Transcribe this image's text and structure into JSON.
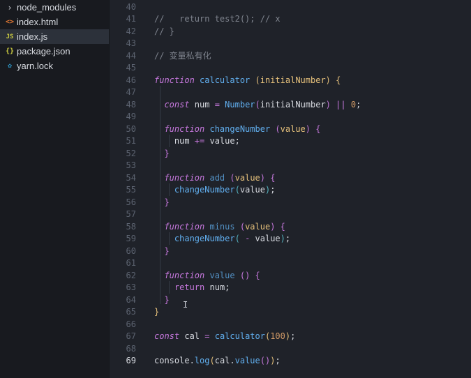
{
  "sidebar": {
    "files": [
      {
        "icon": "chevron-right-icon",
        "glyph": "›",
        "label": "node_modules",
        "type": "folder"
      },
      {
        "icon": "html-file-icon",
        "glyph": "<>",
        "label": "index.html",
        "type": "html"
      },
      {
        "icon": "js-file-icon",
        "glyph": "JS",
        "label": "index.js",
        "type": "js",
        "active": true
      },
      {
        "icon": "json-file-icon",
        "glyph": "{}",
        "label": "package.json",
        "type": "json"
      },
      {
        "icon": "yarn-file-icon",
        "glyph": "✿",
        "label": "yarn.lock",
        "type": "yarn"
      }
    ]
  },
  "editor": {
    "current_line": 69,
    "lines": [
      {
        "n": 40,
        "tokens": []
      },
      {
        "n": 41,
        "tokens": [
          [
            "cmt",
            "//   return test2(); // x"
          ]
        ]
      },
      {
        "n": 42,
        "tokens": [
          [
            "cmt",
            "// }"
          ]
        ]
      },
      {
        "n": 43,
        "tokens": []
      },
      {
        "n": 44,
        "tokens": [
          [
            "cmt",
            "// 变量私有化"
          ]
        ]
      },
      {
        "n": 45,
        "tokens": []
      },
      {
        "n": 46,
        "tokens": [
          [
            "kw",
            "function"
          ],
          [
            "pl",
            " "
          ],
          [
            "fn",
            "calculator"
          ],
          [
            "pl",
            " "
          ],
          [
            "br1",
            "("
          ],
          [
            "prm",
            "initialNumber"
          ],
          [
            "br1",
            ")"
          ],
          [
            "pl",
            " "
          ],
          [
            "br1",
            "{"
          ]
        ]
      },
      {
        "n": 47,
        "tokens": []
      },
      {
        "n": 48,
        "tokens": [
          [
            "pl",
            "  "
          ],
          [
            "kw",
            "const"
          ],
          [
            "pl",
            " num "
          ],
          [
            "op",
            "="
          ],
          [
            "pl",
            " "
          ],
          [
            "fn",
            "Number"
          ],
          [
            "br2",
            "("
          ],
          [
            "pl",
            "initialNumber"
          ],
          [
            "br2",
            ")"
          ],
          [
            "pl",
            " "
          ],
          [
            "op",
            "||"
          ],
          [
            "pl",
            " "
          ],
          [
            "num",
            "0"
          ],
          [
            "pl",
            ";"
          ]
        ]
      },
      {
        "n": 49,
        "tokens": []
      },
      {
        "n": 50,
        "tokens": [
          [
            "pl",
            "  "
          ],
          [
            "kw",
            "function"
          ],
          [
            "pl",
            " "
          ],
          [
            "fn",
            "changeNumber"
          ],
          [
            "pl",
            " "
          ],
          [
            "br2",
            "("
          ],
          [
            "prm",
            "value"
          ],
          [
            "br2",
            ")"
          ],
          [
            "pl",
            " "
          ],
          [
            "br2",
            "{"
          ]
        ]
      },
      {
        "n": 51,
        "tokens": [
          [
            "pl",
            "    num "
          ],
          [
            "op",
            "+="
          ],
          [
            "pl",
            " value;"
          ]
        ]
      },
      {
        "n": 52,
        "tokens": [
          [
            "pl",
            "  "
          ],
          [
            "br2",
            "}"
          ]
        ]
      },
      {
        "n": 53,
        "tokens": []
      },
      {
        "n": 54,
        "tokens": [
          [
            "pl",
            "  "
          ],
          [
            "kw",
            "function"
          ],
          [
            "pl",
            " "
          ],
          [
            "fnd",
            "add"
          ],
          [
            "pl",
            " "
          ],
          [
            "br2",
            "("
          ],
          [
            "prm",
            "value"
          ],
          [
            "br2",
            ")"
          ],
          [
            "pl",
            " "
          ],
          [
            "br2",
            "{"
          ]
        ]
      },
      {
        "n": 55,
        "tokens": [
          [
            "pl",
            "    "
          ],
          [
            "fn",
            "changeNumber"
          ],
          [
            "br3",
            "("
          ],
          [
            "pl",
            "value"
          ],
          [
            "br3",
            ")"
          ],
          [
            "pl",
            ";"
          ]
        ]
      },
      {
        "n": 56,
        "tokens": [
          [
            "pl",
            "  "
          ],
          [
            "br2",
            "}"
          ]
        ]
      },
      {
        "n": 57,
        "tokens": []
      },
      {
        "n": 58,
        "tokens": [
          [
            "pl",
            "  "
          ],
          [
            "kw",
            "function"
          ],
          [
            "pl",
            " "
          ],
          [
            "fnd",
            "minus"
          ],
          [
            "pl",
            " "
          ],
          [
            "br2",
            "("
          ],
          [
            "prm",
            "value"
          ],
          [
            "br2",
            ")"
          ],
          [
            "pl",
            " "
          ],
          [
            "br2",
            "{"
          ]
        ]
      },
      {
        "n": 59,
        "tokens": [
          [
            "pl",
            "    "
          ],
          [
            "fn",
            "changeNumber"
          ],
          [
            "br3",
            "("
          ],
          [
            "pl",
            " "
          ],
          [
            "op",
            "-"
          ],
          [
            "pl",
            " value"
          ],
          [
            "br3",
            ")"
          ],
          [
            "pl",
            ";"
          ]
        ]
      },
      {
        "n": 60,
        "tokens": [
          [
            "pl",
            "  "
          ],
          [
            "br2",
            "}"
          ]
        ]
      },
      {
        "n": 61,
        "tokens": []
      },
      {
        "n": 62,
        "tokens": [
          [
            "pl",
            "  "
          ],
          [
            "kw",
            "function"
          ],
          [
            "pl",
            " "
          ],
          [
            "fnd",
            "value"
          ],
          [
            "pl",
            " "
          ],
          [
            "br2",
            "()"
          ],
          [
            "pl",
            " "
          ],
          [
            "br2",
            "{"
          ]
        ]
      },
      {
        "n": 63,
        "tokens": [
          [
            "pl",
            "    "
          ],
          [
            "br2",
            "return"
          ],
          [
            "pl",
            " num;"
          ]
        ]
      },
      {
        "n": 64,
        "tokens": [
          [
            "pl",
            "  "
          ],
          [
            "br2",
            "}"
          ]
        ]
      },
      {
        "n": 65,
        "tokens": [
          [
            "br1",
            "}"
          ]
        ]
      },
      {
        "n": 66,
        "tokens": []
      },
      {
        "n": 67,
        "tokens": [
          [
            "kw",
            "const"
          ],
          [
            "pl",
            " cal "
          ],
          [
            "op",
            "="
          ],
          [
            "pl",
            " "
          ],
          [
            "fn",
            "calculator"
          ],
          [
            "br1",
            "("
          ],
          [
            "num",
            "100"
          ],
          [
            "br1",
            ")"
          ],
          [
            "pl",
            ";"
          ]
        ]
      },
      {
        "n": 68,
        "tokens": []
      },
      {
        "n": 69,
        "tokens": [
          [
            "pl",
            "console."
          ],
          [
            "fn",
            "log"
          ],
          [
            "br1",
            "("
          ],
          [
            "pl",
            "cal."
          ],
          [
            "fn",
            "value"
          ],
          [
            "br2",
            "()"
          ],
          [
            "br1",
            ")"
          ],
          [
            "pl",
            ";"
          ]
        ]
      }
    ]
  },
  "cursor_glyph": "I"
}
